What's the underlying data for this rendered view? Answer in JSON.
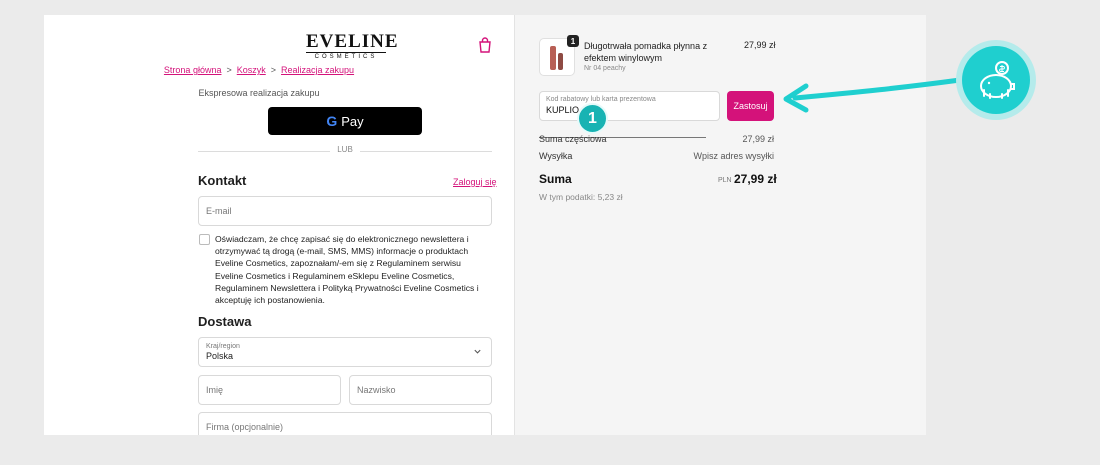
{
  "brand": {
    "logo_main": "EVELINE",
    "logo_sub": "COSMETICS"
  },
  "colors": {
    "accent": "#d4127a",
    "teal": "#1fcfcf",
    "page_bg": "#ebebeb"
  },
  "icons": {
    "cart": "shopping-bag-icon",
    "chevron": "chevron-down-icon",
    "piggy": "piggy-bank-coin-icon",
    "gpay": "google-g-icon"
  },
  "breadcrumb": {
    "items": [
      "Strona główna",
      "Koszyk",
      "Realizacja zakupu"
    ],
    "separator": ">"
  },
  "express": {
    "label": "Ekspresowa realizacja zakupu",
    "gpay_g": "G",
    "gpay_text": "Pay",
    "or": "LUB"
  },
  "contact": {
    "heading": "Kontakt",
    "login_link": "Zaloguj się",
    "email_placeholder": "E-mail",
    "consent": "Oświadczam, że chcę zapisać się do elektronicznego newslettera i otrzymywać tą drogą (e-mail, SMS, MMS) informacje o produktach Eveline Cosmetics, zapoznałam/-em się z Regulaminem serwisu Eveline Cosmetics i Regulaminem eSklepu Eveline Cosmetics, Regulaminem Newslettera i Polityką Prywatności Eveline Cosmetics i akceptuję ich postanowienia."
  },
  "delivery": {
    "heading": "Dostawa",
    "country_label": "Kraj/region",
    "country_value": "Polska",
    "first_name": "Imię",
    "last_name": "Nazwisko",
    "company": "Firma (opcjonalnie)"
  },
  "cart": {
    "item": {
      "quantity": "1",
      "name": "Długotrwała pomadka płynna z efektem winylowym",
      "variant": "Nr 04 peachy",
      "price": "27,99 zł"
    },
    "discount_label": "Kod rabatowy lub karta prezentowa",
    "discount_value": "KUPLIO",
    "apply_button": "Zastosuj",
    "step_badge": "1",
    "subtotal_label": "Suma częściowa",
    "subtotal_value": "27,99 zł",
    "shipping_label": "Wysyłka",
    "shipping_value": "Wpisz adres wysyłki",
    "total_label": "Suma",
    "total_currency": "PLN",
    "total_value": "27,99 zł",
    "tax_text": "W tym podatki: 5,23 zł"
  }
}
